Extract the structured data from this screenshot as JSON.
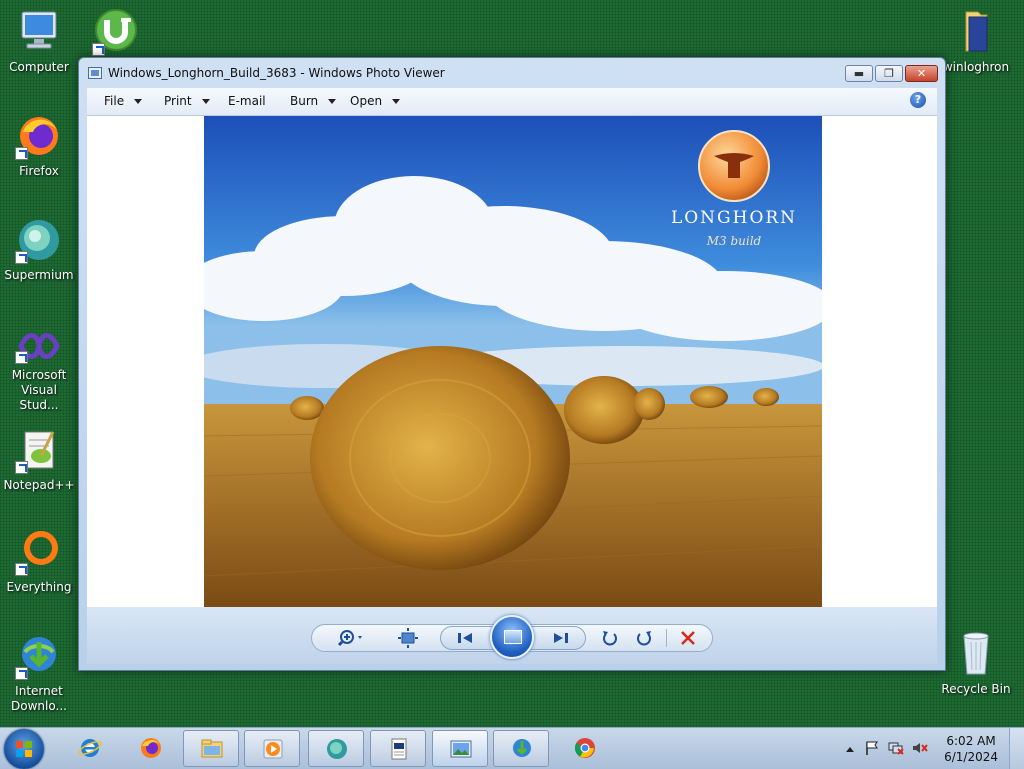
{
  "desktop": {
    "icons": [
      {
        "label": "Computer"
      },
      {
        "label": ""
      },
      {
        "label": "Firefox"
      },
      {
        "label": "Supermium"
      },
      {
        "label": "Microsoft Visual Stud..."
      },
      {
        "label": "Notepad++"
      },
      {
        "label": "Everything"
      },
      {
        "label": "Internet Downlo..."
      },
      {
        "label": "winloghron"
      },
      {
        "label": "Recycle Bin"
      }
    ]
  },
  "window": {
    "title": "Windows_Longhorn_Build_3683 - Windows Photo Viewer",
    "caption": {
      "minimize": "▬",
      "restore": "❐",
      "close": "✕"
    },
    "menu": [
      {
        "label": "File",
        "has_arrow": true
      },
      {
        "label": "Print",
        "has_arrow": true
      },
      {
        "label": "E-mail",
        "has_arrow": false
      },
      {
        "label": "Burn",
        "has_arrow": true
      },
      {
        "label": "Open",
        "has_arrow": true
      }
    ],
    "help": "?",
    "photo": {
      "brand": "LONGHORN",
      "subtitle": "M3 build"
    },
    "controls": [
      "zoom-icon",
      "actual-size-icon",
      "previous-icon",
      "slideshow-icon",
      "next-icon",
      "rotate-counterclockwise-icon",
      "rotate-clockwise-icon",
      "delete-icon"
    ]
  },
  "taskbar": {
    "clock_time": "6:02 AM",
    "clock_date": "6/1/2024",
    "buttons": [
      "internet-explorer",
      "firefox",
      "file-explorer",
      "media-player",
      "supermium",
      "document",
      "photo-viewer",
      "internet-download-manager",
      "chrome"
    ]
  },
  "colors": {
    "desktop": "#1d6a33",
    "window_chrome": "#cfe0f3",
    "accent": "#1f5fc0",
    "close": "#c7432a"
  }
}
